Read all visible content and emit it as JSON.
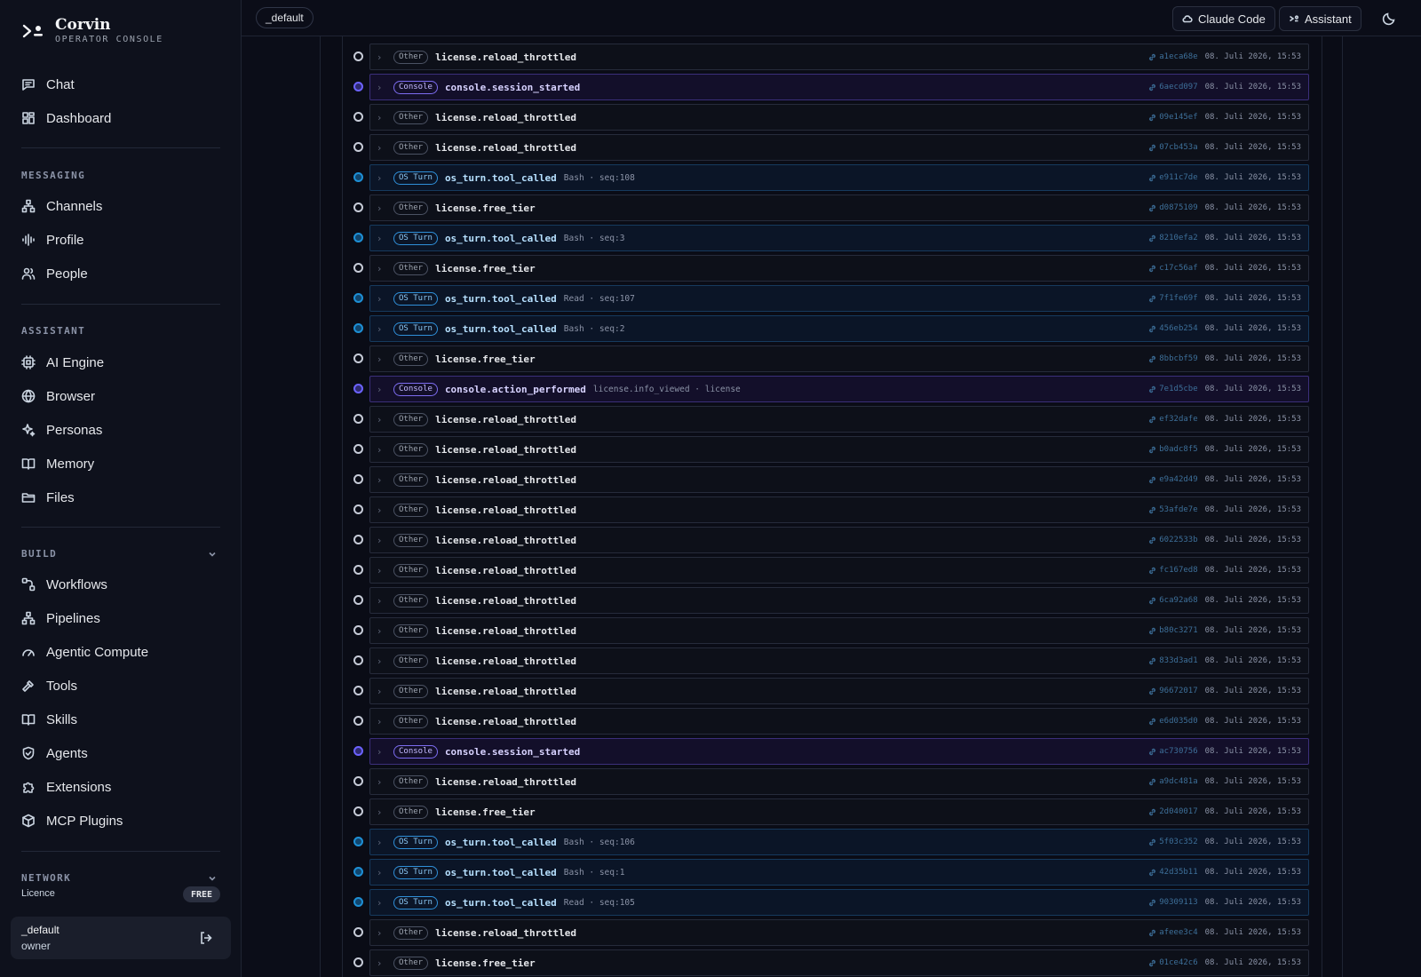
{
  "brand": {
    "name": "Corvin",
    "subtitle": "OPERATOR CONSOLE"
  },
  "nav": {
    "top": [
      {
        "id": "chat",
        "label": "Chat",
        "icon": "chat-icon"
      },
      {
        "id": "dashboard",
        "label": "Dashboard",
        "icon": "dashboard-icon"
      }
    ],
    "messaging": {
      "label": "MESSAGING",
      "items": [
        {
          "id": "channels",
          "label": "Channels",
          "icon": "channels-icon"
        },
        {
          "id": "profile",
          "label": "Profile",
          "icon": "waveform-icon"
        },
        {
          "id": "people",
          "label": "People",
          "icon": "people-icon"
        }
      ]
    },
    "assistant": {
      "label": "ASSISTANT",
      "items": [
        {
          "id": "ai-engine",
          "label": "AI Engine",
          "icon": "cpu-icon"
        },
        {
          "id": "browser",
          "label": "Browser",
          "icon": "globe-icon"
        },
        {
          "id": "personas",
          "label": "Personas",
          "icon": "sparkles-icon"
        },
        {
          "id": "memory",
          "label": "Memory",
          "icon": "book-icon"
        },
        {
          "id": "files",
          "label": "Files",
          "icon": "folder-icon"
        }
      ]
    },
    "build": {
      "label": "BUILD",
      "items": [
        {
          "id": "workflows",
          "label": "Workflows",
          "icon": "workflow-icon"
        },
        {
          "id": "pipelines",
          "label": "Pipelines",
          "icon": "pipeline-icon"
        },
        {
          "id": "agentic-compute",
          "label": "Agentic Compute",
          "icon": "gauge-icon"
        },
        {
          "id": "tools",
          "label": "Tools",
          "icon": "hammer-icon"
        },
        {
          "id": "skills",
          "label": "Skills",
          "icon": "book-open-icon"
        },
        {
          "id": "agents",
          "label": "Agents",
          "icon": "shield-icon"
        },
        {
          "id": "extensions",
          "label": "Extensions",
          "icon": "puzzle-icon"
        },
        {
          "id": "mcp-plugins",
          "label": "MCP Plugins",
          "icon": "package-icon"
        }
      ]
    },
    "network": {
      "label": "NETWORK"
    }
  },
  "licence": {
    "label": "Licence",
    "badge": "FREE"
  },
  "user": {
    "name": "_default",
    "role": "owner"
  },
  "topbar": {
    "workspace": "_default",
    "claude_code": "Claude Code",
    "assistant": "Assistant"
  },
  "events": [
    {
      "type": "other",
      "badge": "Other",
      "name": "license.reload_throttled",
      "detail": "",
      "hash": "a1eca68e",
      "ts": "08. Juli 2026, 15:53"
    },
    {
      "type": "console",
      "badge": "Console",
      "name": "console.session_started",
      "detail": "",
      "hash": "6aecd097",
      "ts": "08. Juli 2026, 15:53"
    },
    {
      "type": "other",
      "badge": "Other",
      "name": "license.reload_throttled",
      "detail": "",
      "hash": "09e145ef",
      "ts": "08. Juli 2026, 15:53"
    },
    {
      "type": "other",
      "badge": "Other",
      "name": "license.reload_throttled",
      "detail": "",
      "hash": "07cb453a",
      "ts": "08. Juli 2026, 15:53"
    },
    {
      "type": "osturn",
      "badge": "OS Turn",
      "name": "os_turn.tool_called",
      "detail": "Bash · seq:108",
      "hash": "e911c7de",
      "ts": "08. Juli 2026, 15:53"
    },
    {
      "type": "other",
      "badge": "Other",
      "name": "license.free_tier",
      "detail": "",
      "hash": "d0875109",
      "ts": "08. Juli 2026, 15:53"
    },
    {
      "type": "osturn",
      "badge": "OS Turn",
      "name": "os_turn.tool_called",
      "detail": "Bash · seq:3",
      "hash": "8210efa2",
      "ts": "08. Juli 2026, 15:53"
    },
    {
      "type": "other",
      "badge": "Other",
      "name": "license.free_tier",
      "detail": "",
      "hash": "c17c56af",
      "ts": "08. Juli 2026, 15:53"
    },
    {
      "type": "osturn",
      "badge": "OS Turn",
      "name": "os_turn.tool_called",
      "detail": "Read · seq:107",
      "hash": "7f1fe69f",
      "ts": "08. Juli 2026, 15:53"
    },
    {
      "type": "osturn",
      "badge": "OS Turn",
      "name": "os_turn.tool_called",
      "detail": "Bash · seq:2",
      "hash": "456eb254",
      "ts": "08. Juli 2026, 15:53"
    },
    {
      "type": "other",
      "badge": "Other",
      "name": "license.free_tier",
      "detail": "",
      "hash": "8bbcbf59",
      "ts": "08. Juli 2026, 15:53"
    },
    {
      "type": "console",
      "badge": "Console",
      "name": "console.action_performed",
      "detail": "license.info_viewed · license",
      "hash": "7e1d5cbe",
      "ts": "08. Juli 2026, 15:53"
    },
    {
      "type": "other",
      "badge": "Other",
      "name": "license.reload_throttled",
      "detail": "",
      "hash": "ef32dafe",
      "ts": "08. Juli 2026, 15:53"
    },
    {
      "type": "other",
      "badge": "Other",
      "name": "license.reload_throttled",
      "detail": "",
      "hash": "b0adc8f5",
      "ts": "08. Juli 2026, 15:53"
    },
    {
      "type": "other",
      "badge": "Other",
      "name": "license.reload_throttled",
      "detail": "",
      "hash": "e9a42d49",
      "ts": "08. Juli 2026, 15:53"
    },
    {
      "type": "other",
      "badge": "Other",
      "name": "license.reload_throttled",
      "detail": "",
      "hash": "53afde7e",
      "ts": "08. Juli 2026, 15:53"
    },
    {
      "type": "other",
      "badge": "Other",
      "name": "license.reload_throttled",
      "detail": "",
      "hash": "6022533b",
      "ts": "08. Juli 2026, 15:53"
    },
    {
      "type": "other",
      "badge": "Other",
      "name": "license.reload_throttled",
      "detail": "",
      "hash": "fc167ed8",
      "ts": "08. Juli 2026, 15:53"
    },
    {
      "type": "other",
      "badge": "Other",
      "name": "license.reload_throttled",
      "detail": "",
      "hash": "6ca92a68",
      "ts": "08. Juli 2026, 15:53"
    },
    {
      "type": "other",
      "badge": "Other",
      "name": "license.reload_throttled",
      "detail": "",
      "hash": "b80c3271",
      "ts": "08. Juli 2026, 15:53"
    },
    {
      "type": "other",
      "badge": "Other",
      "name": "license.reload_throttled",
      "detail": "",
      "hash": "833d3ad1",
      "ts": "08. Juli 2026, 15:53"
    },
    {
      "type": "other",
      "badge": "Other",
      "name": "license.reload_throttled",
      "detail": "",
      "hash": "96672017",
      "ts": "08. Juli 2026, 15:53"
    },
    {
      "type": "other",
      "badge": "Other",
      "name": "license.reload_throttled",
      "detail": "",
      "hash": "e6d035d0",
      "ts": "08. Juli 2026, 15:53"
    },
    {
      "type": "console",
      "badge": "Console",
      "name": "console.session_started",
      "detail": "",
      "hash": "ac730756",
      "ts": "08. Juli 2026, 15:53"
    },
    {
      "type": "other",
      "badge": "Other",
      "name": "license.reload_throttled",
      "detail": "",
      "hash": "a9dc481a",
      "ts": "08. Juli 2026, 15:53"
    },
    {
      "type": "other",
      "badge": "Other",
      "name": "license.free_tier",
      "detail": "",
      "hash": "2d040017",
      "ts": "08. Juli 2026, 15:53"
    },
    {
      "type": "osturn",
      "badge": "OS Turn",
      "name": "os_turn.tool_called",
      "detail": "Bash · seq:106",
      "hash": "5f03c352",
      "ts": "08. Juli 2026, 15:53"
    },
    {
      "type": "osturn",
      "badge": "OS Turn",
      "name": "os_turn.tool_called",
      "detail": "Bash · seq:1",
      "hash": "42d35b11",
      "ts": "08. Juli 2026, 15:53"
    },
    {
      "type": "osturn",
      "badge": "OS Turn",
      "name": "os_turn.tool_called",
      "detail": "Read · seq:105",
      "hash": "90309113",
      "ts": "08. Juli 2026, 15:53"
    },
    {
      "type": "other",
      "badge": "Other",
      "name": "license.reload_throttled",
      "detail": "",
      "hash": "afeee3c4",
      "ts": "08. Juli 2026, 15:53"
    },
    {
      "type": "other",
      "badge": "Other",
      "name": "license.free_tier",
      "detail": "",
      "hash": "01ce42c6",
      "ts": "08. Juli 2026, 15:53"
    }
  ]
}
